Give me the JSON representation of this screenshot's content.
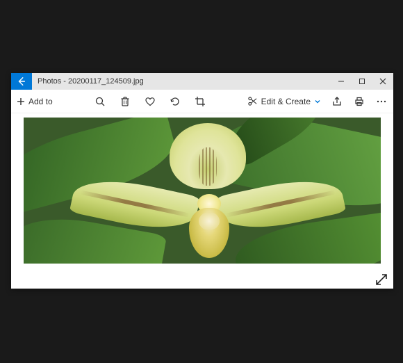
{
  "window": {
    "app_name": "Photos",
    "file_name": "20200117_124509.jpg",
    "title": "Photos - 20200117_124509.jpg"
  },
  "toolbar": {
    "add_to_label": "Add to",
    "edit_create_label": "Edit & Create"
  },
  "icons": {
    "back": "back-arrow",
    "minimize": "minimize",
    "maximize": "maximize",
    "close": "close",
    "plus": "plus",
    "zoom": "zoom",
    "delete": "delete",
    "favorite": "heart",
    "rotate": "rotate",
    "crop": "crop",
    "edit": "scissors",
    "share": "share",
    "print": "print",
    "more": "more",
    "expand": "expand-diagonal"
  }
}
